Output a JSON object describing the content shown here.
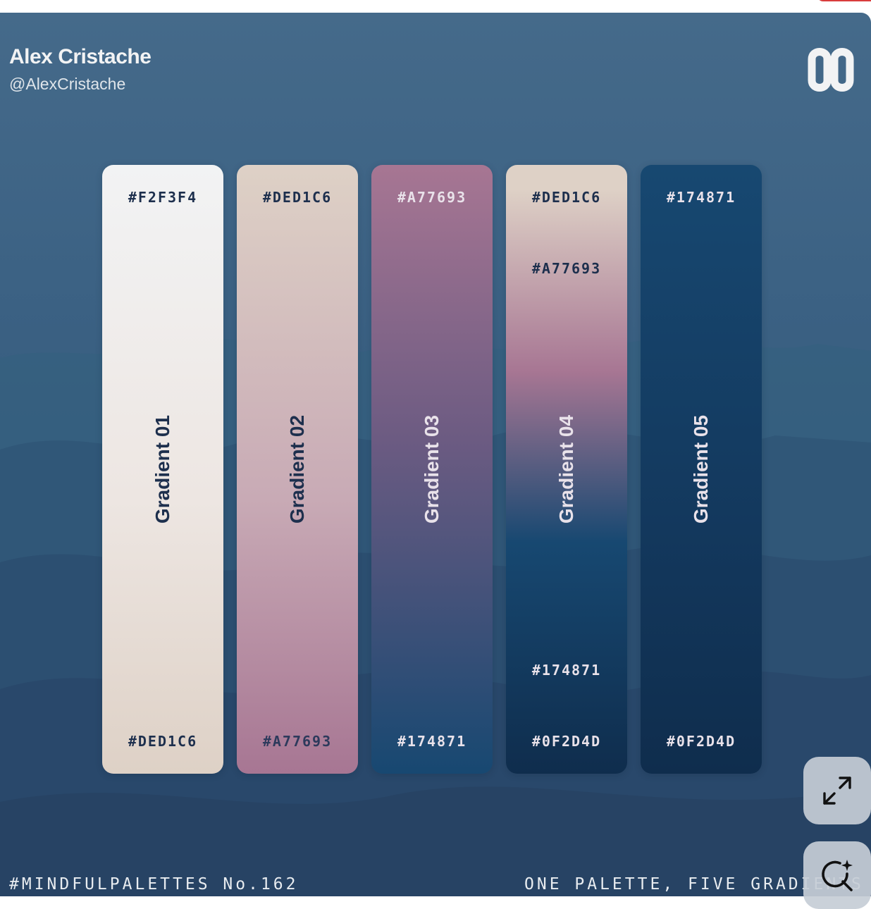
{
  "author": {
    "name": "Alex Cristache",
    "handle": "@AlexCristache"
  },
  "swatches": [
    {
      "label": "Gradient 01",
      "stops": [
        "#F2F3F4",
        "#DED1C6"
      ]
    },
    {
      "label": "Gradient 02",
      "stops": [
        "#DED1C6",
        "#A77693"
      ]
    },
    {
      "label": "Gradient 03",
      "stops": [
        "#A77693",
        "#174871"
      ]
    },
    {
      "label": "Gradient 04",
      "stops": [
        "#DED1C6",
        "#A77693",
        "#174871",
        "#0F2D4D"
      ]
    },
    {
      "label": "Gradient 05",
      "stops": [
        "#174871",
        "#0F2D4D"
      ]
    }
  ],
  "footer": {
    "left": "#MINDFULPALETTES No.162",
    "right": "ONE PALETTE, FIVE GRADIENTS"
  },
  "controls": {
    "expand_icon": "expand-icon",
    "visual_search_icon": "visual-search-icon"
  },
  "colors": {
    "background": "#3c6284",
    "accent_badge": "#d93c3c"
  }
}
